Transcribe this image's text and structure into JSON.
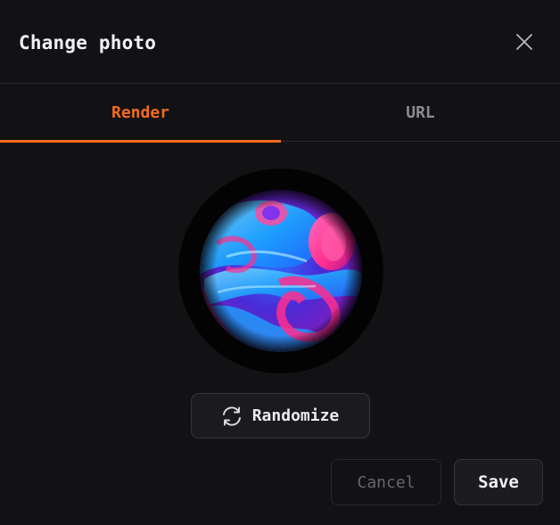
{
  "dialog": {
    "title": "Change photo",
    "close_icon": "close-icon"
  },
  "tabs": [
    {
      "label": "Render",
      "active": true
    },
    {
      "label": "URL",
      "active": false
    }
  ],
  "avatar": {
    "image": "abstract-swirl-render",
    "colors": [
      "#1aa9ff",
      "#ff2d8f",
      "#6a2bff",
      "#1b1b6e"
    ]
  },
  "randomize": {
    "label": "Randomize",
    "icon": "refresh-icon"
  },
  "footer": {
    "cancel_label": "Cancel",
    "save_label": "Save"
  },
  "colors": {
    "accent": "#f26b1d",
    "background": "#121214",
    "border": "#2a2a2f"
  }
}
